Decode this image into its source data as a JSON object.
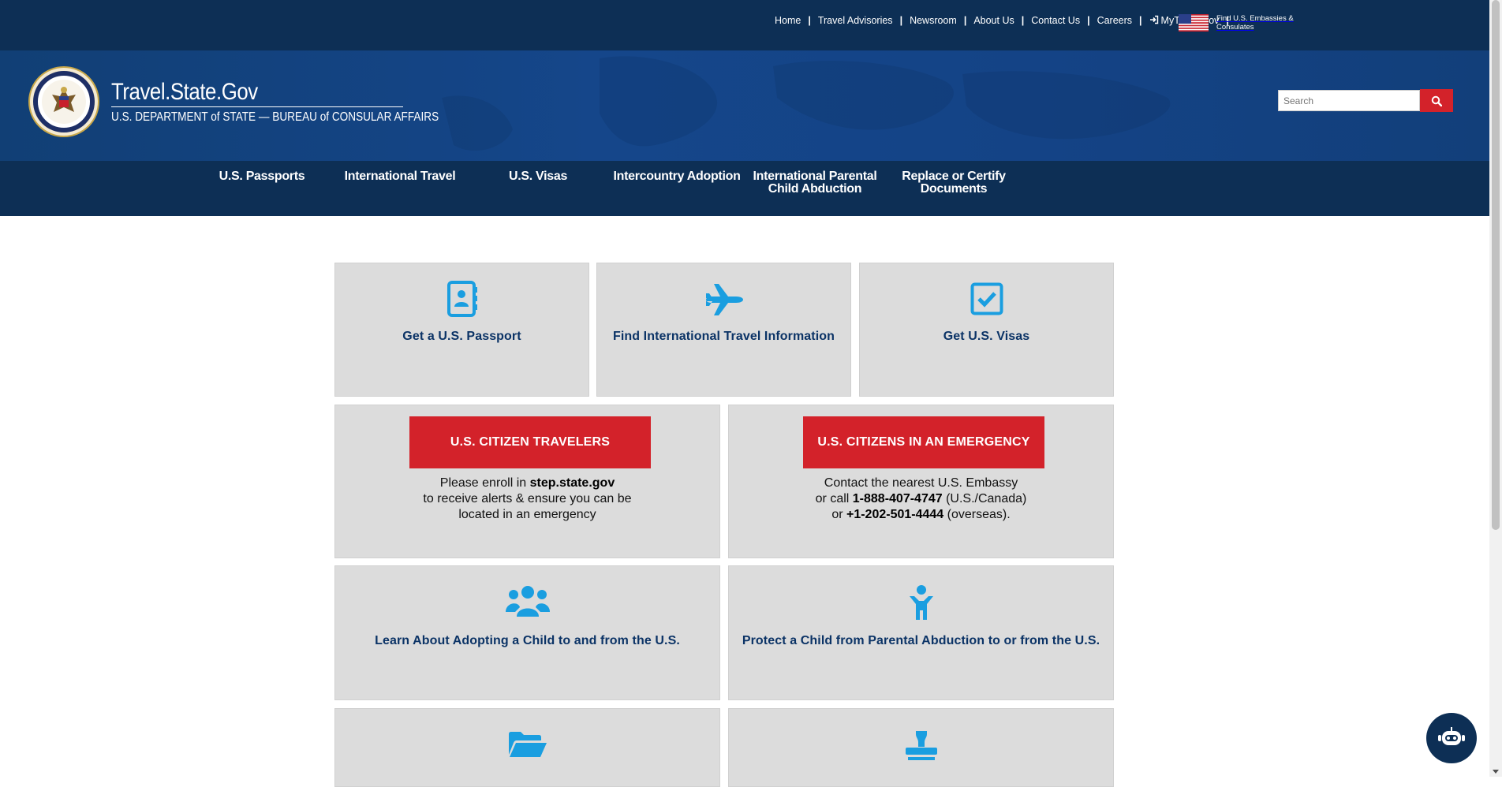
{
  "utility_nav": {
    "items": [
      "Home",
      "Travel Advisories",
      "Newsroom",
      "About Us",
      "Contact Us",
      "Careers",
      "MyTravelGov"
    ],
    "embassies_label": "Find U.S. Embassies & Consulates"
  },
  "header": {
    "title": "Travel.State.Gov",
    "subtitle": "U.S. DEPARTMENT of STATE — BUREAU of CONSULAR AFFAIRS",
    "search_placeholder": "Search"
  },
  "main_nav": {
    "items": [
      "U.S. Passports",
      "International Travel",
      "U.S. Visas",
      "Intercountry Adoption",
      "International Parental Child Abduction",
      "Replace or Certify Documents"
    ]
  },
  "tiles": {
    "passport": "Get a U.S. Passport",
    "travel": "Find International Travel Information",
    "visas": "Get U.S. Visas",
    "adoption": "Learn About Adopting a Child to and from the U.S.",
    "abduction": "Protect a Child from Parental Abduction to or from the U.S."
  },
  "travelers": {
    "button": "U.S. CITIZEN TRAVELERS",
    "line1_pre": "Please enroll in ",
    "line1_bold": "step.state.gov",
    "line2": "to receive alerts & ensure you can be",
    "line3": "located in an emergency"
  },
  "emergency": {
    "button": "U.S. CITIZENS IN AN EMERGENCY",
    "line1": "Contact the nearest U.S. Embassy",
    "line2_pre": "or call ",
    "line2_bold": "1-888-407-4747",
    "line2_post": " (U.S./Canada)",
    "line3_pre": "or ",
    "line3_bold": "+1-202-501-4444",
    "line3_post": " (overseas)."
  },
  "colors": {
    "navy": "#0d2f55",
    "header_blue": "#15468a",
    "red": "#d3222a",
    "tile_gray": "#dcdcdc",
    "icon_blue": "#1a9ee0",
    "label_navy": "#0b3366"
  }
}
